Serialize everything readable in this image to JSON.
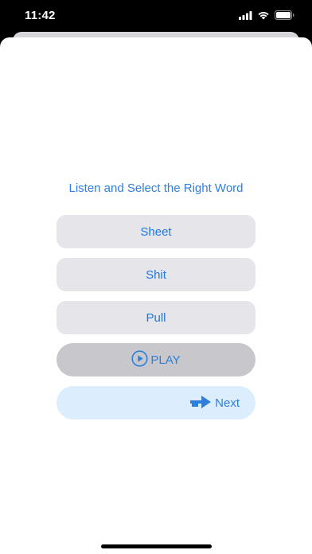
{
  "status_bar": {
    "time": "11:42"
  },
  "quiz": {
    "prompt": "Listen and Select the Right Word",
    "options": [
      "Sheet",
      "Shit",
      "Pull"
    ],
    "play_label": "PLAY",
    "next_label": "Next"
  },
  "colors": {
    "accent": "#2d7ee6",
    "option_bg": "#e5e5ea",
    "play_bg": "#c8c8cc",
    "next_bg": "#dceefd"
  },
  "icons": {
    "signal": "cellular-signal-icon",
    "wifi": "wifi-icon",
    "battery": "battery-icon",
    "play": "play-circle-icon",
    "next": "arrow-right-icon"
  }
}
